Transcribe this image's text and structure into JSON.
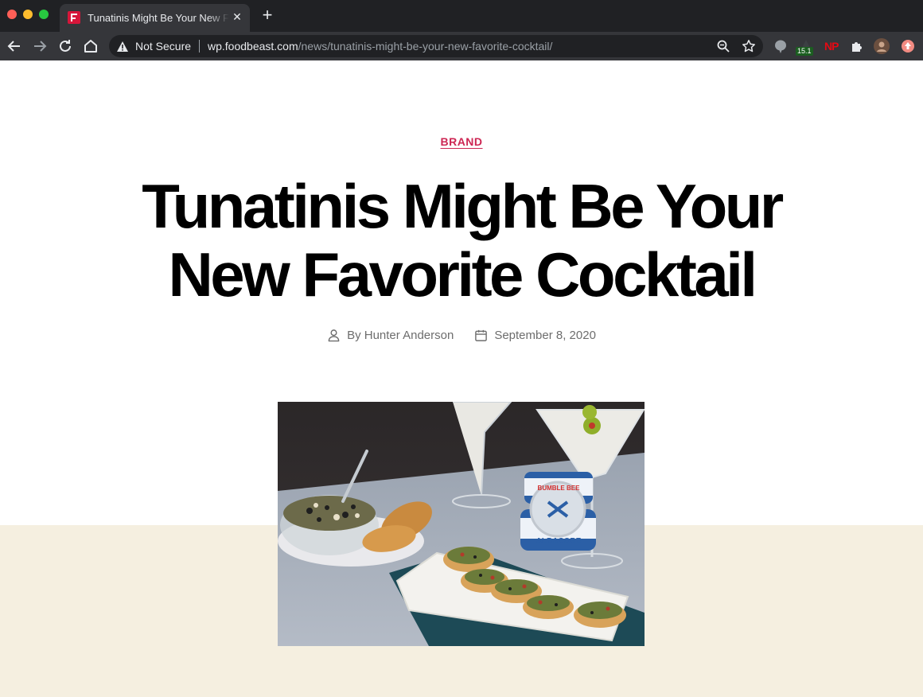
{
  "browser": {
    "tab_title": "Tunatinis Might Be Your New Favorite Cocktail",
    "close_glyph": "✕",
    "new_tab_glyph": "+",
    "security_label": "Not Secure",
    "url_host": "wp.foodbeast.com",
    "url_path": "/news/tunatinis-might-be-your-new-favorite-cocktail/",
    "extension_badge": "15.1",
    "extension_np_label": "NP"
  },
  "article": {
    "category": "BRAND",
    "title": "Tunatinis Might Be Your New Favorite Cocktail",
    "author": "By Hunter Anderson",
    "date": "September 8, 2020"
  },
  "hero_image": {
    "can_brand": "BUMBLE BEE",
    "can_product": "ALBACORE"
  },
  "colors": {
    "accent": "#cd2653",
    "band": "#f5efe0",
    "browser_dark": "#202124"
  }
}
